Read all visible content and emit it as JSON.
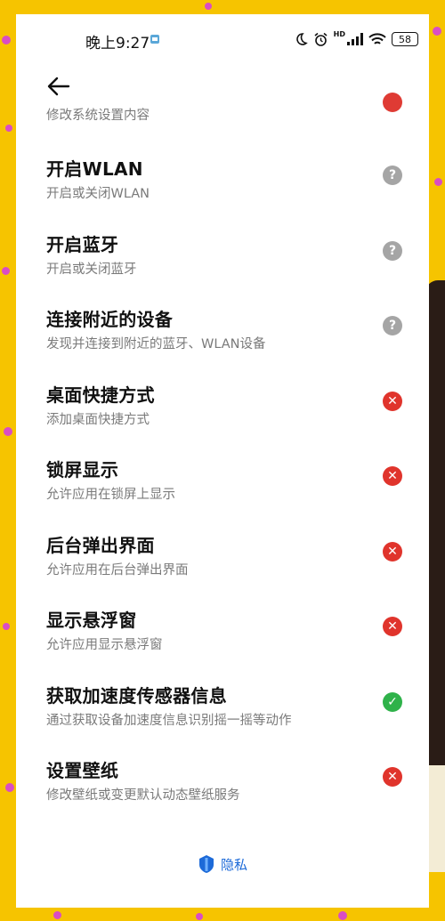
{
  "status_bar": {
    "time": "晚上9:27",
    "hd_label": "HD",
    "battery": "58",
    "icons": [
      "moon-icon",
      "alarm-icon",
      "signal-icon",
      "wifi-icon",
      "battery-icon"
    ]
  },
  "nav": {
    "back_icon": "back-arrow-icon"
  },
  "partial_row": {
    "desc": "修改系统设置内容",
    "status": "deny"
  },
  "permissions": [
    {
      "title": "开启WLAN",
      "desc": "开启或关闭WLAN",
      "status": "unknown"
    },
    {
      "title": "开启蓝牙",
      "desc": "开启或关闭蓝牙",
      "status": "unknown"
    },
    {
      "title": "连接附近的设备",
      "desc": "发现并连接到附近的蓝牙、WLAN设备",
      "status": "unknown"
    },
    {
      "title": "桌面快捷方式",
      "desc": "添加桌面快捷方式",
      "status": "deny"
    },
    {
      "title": "锁屏显示",
      "desc": "允许应用在锁屏上显示",
      "status": "deny"
    },
    {
      "title": "后台弹出界面",
      "desc": "允许应用在后台弹出界面",
      "status": "deny"
    },
    {
      "title": "显示悬浮窗",
      "desc": "允许应用显示悬浮窗",
      "status": "deny"
    },
    {
      "title": "获取加速度传感器信息",
      "desc": "通过获取设备加速度信息识别摇一摇等动作",
      "status": "allow"
    },
    {
      "title": "设置壁纸",
      "desc": "修改壁纸或变更默认动态壁纸服务",
      "status": "deny"
    }
  ],
  "status_symbols": {
    "unknown": "?",
    "deny": "✕",
    "allow": "✓"
  },
  "colors": {
    "unknown": "#a5a5a5",
    "deny": "#e0342c",
    "allow": "#2fb24a",
    "link": "#1d6ad8",
    "background": "#f6c400"
  },
  "footer": {
    "privacy_label": "隐私",
    "privacy_icon": "privacy-shield-icon"
  }
}
